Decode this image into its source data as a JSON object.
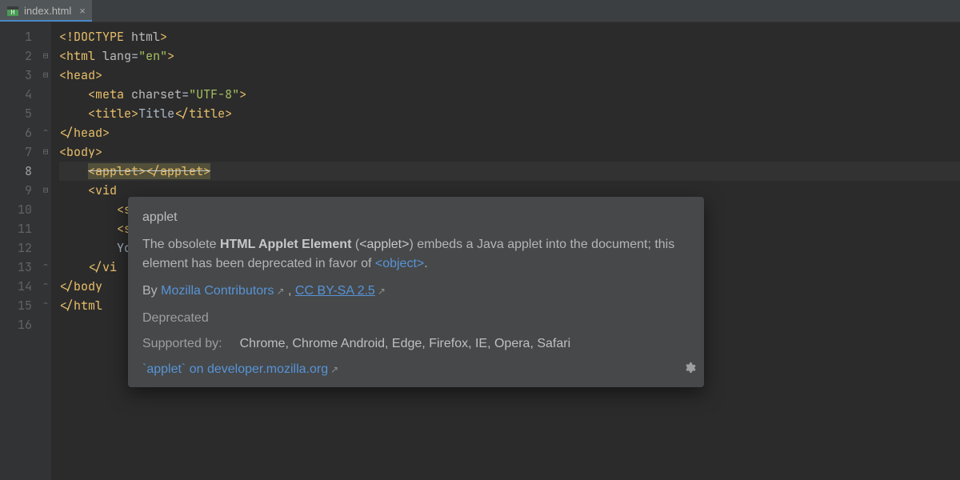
{
  "tab": {
    "filename": "index.html",
    "close_tooltip": "Close"
  },
  "gutter": {
    "lines": [
      "1",
      "2",
      "3",
      "4",
      "5",
      "6",
      "7",
      "8",
      "9",
      "10",
      "11",
      "12",
      "13",
      "14",
      "15",
      "16"
    ],
    "current_line": 8,
    "fold_markers": {
      "2": "open",
      "3": "open",
      "6": "close",
      "7": "open",
      "9": "open",
      "13": "close",
      "14": "close",
      "15": "close"
    }
  },
  "code": {
    "lines": [
      {
        "n": 1,
        "segments": [
          {
            "t": "<!DOCTYPE ",
            "c": "tok-tag"
          },
          {
            "t": "html",
            "c": "tok-attr"
          },
          {
            "t": ">",
            "c": "tok-tag"
          }
        ]
      },
      {
        "n": 2,
        "segments": [
          {
            "t": "<",
            "c": "tok-angle"
          },
          {
            "t": "html ",
            "c": "tok-tag"
          },
          {
            "t": "lang",
            "c": "tok-attr"
          },
          {
            "t": "=",
            "c": "tok-text"
          },
          {
            "t": "\"en\"",
            "c": "tok-str"
          },
          {
            "t": ">",
            "c": "tok-angle"
          }
        ]
      },
      {
        "n": 3,
        "segments": [
          {
            "t": "<",
            "c": "tok-angle"
          },
          {
            "t": "head",
            "c": "tok-tag"
          },
          {
            "t": ">",
            "c": "tok-angle"
          }
        ]
      },
      {
        "n": 4,
        "indent": 1,
        "segments": [
          {
            "t": "<",
            "c": "tok-angle"
          },
          {
            "t": "meta ",
            "c": "tok-tag"
          },
          {
            "t": "charset",
            "c": "tok-attr"
          },
          {
            "t": "=",
            "c": "tok-text"
          },
          {
            "t": "\"UTF-8\"",
            "c": "tok-str"
          },
          {
            "t": ">",
            "c": "tok-angle"
          }
        ]
      },
      {
        "n": 5,
        "indent": 1,
        "segments": [
          {
            "t": "<",
            "c": "tok-angle"
          },
          {
            "t": "title",
            "c": "tok-tag"
          },
          {
            "t": ">",
            "c": "tok-angle"
          },
          {
            "t": "Title",
            "c": "tok-text"
          },
          {
            "t": "</",
            "c": "tok-angle"
          },
          {
            "t": "title",
            "c": "tok-tag"
          },
          {
            "t": ">",
            "c": "tok-angle"
          }
        ]
      },
      {
        "n": 6,
        "segments": [
          {
            "t": "</",
            "c": "tok-angle"
          },
          {
            "t": "head",
            "c": "tok-tag"
          },
          {
            "t": ">",
            "c": "tok-angle"
          }
        ]
      },
      {
        "n": 7,
        "segments": [
          {
            "t": "<",
            "c": "tok-angle"
          },
          {
            "t": "body",
            "c": "tok-tag"
          },
          {
            "t": ">",
            "c": "tok-angle"
          }
        ]
      },
      {
        "n": 8,
        "indent": 1,
        "current": true,
        "segments": [
          {
            "t": "<applet></applet>",
            "c": "tok-tag hl-strike"
          }
        ]
      },
      {
        "n": 9,
        "indent": 1,
        "segments": [
          {
            "t": "<",
            "c": "tok-angle"
          },
          {
            "t": "vid",
            "c": "tok-tag"
          }
        ]
      },
      {
        "n": 10,
        "indent": 2,
        "segments": [
          {
            "t": "<",
            "c": "tok-angle"
          },
          {
            "t": "s",
            "c": "tok-tag"
          }
        ]
      },
      {
        "n": 11,
        "indent": 2,
        "segments": [
          {
            "t": "<",
            "c": "tok-angle"
          },
          {
            "t": "s",
            "c": "tok-tag"
          }
        ]
      },
      {
        "n": 12,
        "indent": 2,
        "segments": [
          {
            "t": "Yo",
            "c": "tok-text"
          }
        ]
      },
      {
        "n": 13,
        "indent": 1,
        "segments": [
          {
            "t": "</",
            "c": "tok-angle"
          },
          {
            "t": "vi",
            "c": "tok-tag"
          }
        ]
      },
      {
        "n": 14,
        "segments": [
          {
            "t": "</",
            "c": "tok-angle"
          },
          {
            "t": "body",
            "c": "tok-tag"
          }
        ]
      },
      {
        "n": 15,
        "segments": [
          {
            "t": "</",
            "c": "tok-angle"
          },
          {
            "t": "html",
            "c": "tok-tag"
          }
        ]
      },
      {
        "n": 16,
        "segments": []
      }
    ]
  },
  "popup": {
    "title": "applet",
    "desc_prefix": "The obsolete ",
    "desc_bold": "HTML Applet Element",
    "desc_paren_open": " (",
    "desc_code": "<applet>",
    "desc_paren_close": ") ",
    "desc_mid": "embeds a Java applet into the document; this element has been deprecated in favor of ",
    "desc_link_obj": "<object>",
    "desc_end": ".",
    "by_label": "By ",
    "by_link": "Mozilla Contributors",
    "by_sep": " , ",
    "license_link": "CC BY-SA 2.5",
    "deprecated_label": "Deprecated",
    "supported_label": "Supported by:",
    "supported_value": "Chrome, Chrome Android, Edge, Firefox, IE, Opera, Safari",
    "docs_link": "`applet` on developer.mozilla.org"
  }
}
